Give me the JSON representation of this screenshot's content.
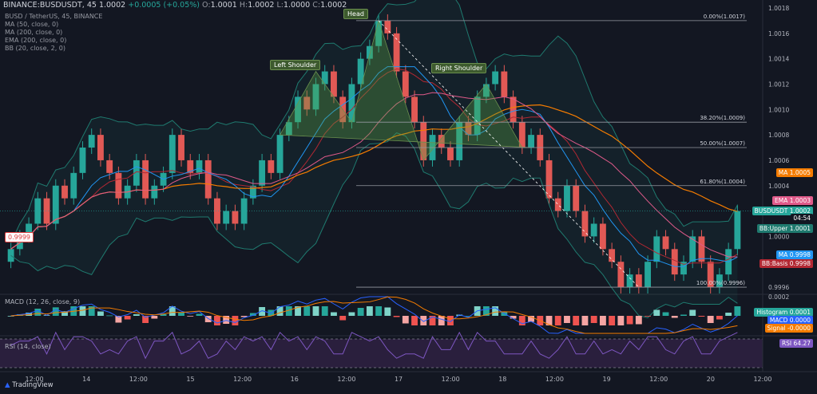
{
  "header": {
    "symbol": "BINANCE:BUSDUSDT, 45",
    "close_value": "1.0002",
    "change": "+0.0005 (+0.05%)",
    "o_label": "O:",
    "o_value": "1.0001",
    "h_label": "H:",
    "h_value": "1.0002",
    "l_label": "L:",
    "l_value": "1.0000",
    "c_label": "C:",
    "c_value": "1.0002"
  },
  "indicators": [
    "BUSD / TetherUS, 45, BINANCE",
    "MA (50, close, 0)",
    "MA (200, close, 0)",
    "EMA (200, close, 0)",
    "BB (20, close, 2, 0)"
  ],
  "patterns": {
    "head": "Head",
    "left_shoulder": "Left Shoulder",
    "right_shoulder": "Right Shoulder"
  },
  "fib_levels": [
    {
      "label": "0.00%(1.0017)",
      "price": 1.0017
    },
    {
      "label": "38.20%(1.0009)",
      "price": 1.0009
    },
    {
      "label": "50.00%(1.0007)",
      "price": 1.0007
    },
    {
      "label": "61.80%(1.0004)",
      "price": 1.0004
    },
    {
      "label": "100.00%(0.9996)",
      "price": 0.9996
    }
  ],
  "price_tags": [
    {
      "label": "MA",
      "value": "1.0005",
      "color": "#f57c00",
      "price": 1.0005
    },
    {
      "label": "EMA",
      "value": "1.0003",
      "color": "#e05a8a",
      "price": 1.00028
    },
    {
      "label": "BUSDUSDT",
      "value": "1.0002",
      "color": "#26a69a",
      "price": 1.0002
    },
    {
      "label": "",
      "value": "04:54",
      "color": "#131722",
      "price": 1.00014
    },
    {
      "label": "BB:Upper",
      "value": "1.0001",
      "color": "#1f7a6f",
      "price": 1.00006
    },
    {
      "label": "MA",
      "value": "0.9998",
      "color": "#2196f3",
      "price": 0.99985
    },
    {
      "label": "BB:Basis",
      "value": "0.9998",
      "color": "#b22833",
      "price": 0.99978
    }
  ],
  "left_price_tag": "0.9999",
  "macd": {
    "label": "MACD (12, 26, close, 9)",
    "tags": [
      {
        "label": "Histogram",
        "value": "0.0001",
        "color": "#26a69a"
      },
      {
        "label": "MACD",
        "value": "0.0000",
        "color": "#2962ff"
      },
      {
        "label": "Signal",
        "value": "-0.0000",
        "color": "#f57c00"
      }
    ],
    "axis_label": "0.0002"
  },
  "rsi": {
    "label": "RSI (14, close)",
    "tag_label": "RSI",
    "tag_value": "64.27",
    "color": "#7e57c2"
  },
  "footer": {
    "brand": "TradingView"
  },
  "chart_data": {
    "type": "candlestick",
    "title": "BUSD / TetherUS, 45, BINANCE",
    "y_ticks": [
      "1.0018",
      "1.0016",
      "1.0014",
      "1.0012",
      "1.0010",
      "1.0008",
      "1.0006",
      "1.0004",
      "1.0002",
      "1.0000",
      "0.9998",
      "0.9996"
    ],
    "ylim": [
      0.99955,
      1.0018
    ],
    "x_ticks": [
      "12:00",
      "14",
      "12:00",
      "15",
      "12:00",
      "16",
      "12:00",
      "17",
      "12:00",
      "18",
      "12:00",
      "19",
      "12:00",
      "20",
      "12:00"
    ],
    "x_range": [
      0,
      14.6
    ],
    "closes": [
      0.9999,
      1.0,
      1.0001,
      1.0003,
      1.0001,
      1.0004,
      1.0003,
      1.0005,
      1.0007,
      1.0008,
      1.0006,
      1.0005,
      1.0003,
      1.0004,
      1.0006,
      1.0003,
      1.0004,
      1.0005,
      1.0008,
      1.0006,
      1.0005,
      1.0006,
      1.0003,
      1.0001,
      1.0002,
      1.0001,
      1.0003,
      1.0004,
      1.0006,
      1.0005,
      1.0008,
      1.0009,
      1.0011,
      1.001,
      1.0012,
      1.0013,
      1.0011,
      1.0009,
      1.0012,
      1.0014,
      1.0015,
      1.0017,
      1.0016,
      1.0013,
      1.0011,
      1.0009,
      1.0006,
      1.0008,
      1.0007,
      1.0006,
      1.0009,
      1.0008,
      1.0011,
      1.0012,
      1.0013,
      1.0011,
      1.0009,
      1.0007,
      1.0008,
      1.0006,
      1.0003,
      1.0002,
      1.0004,
      1.0002,
      1.0,
      1.0001,
      0.9999,
      0.9998,
      0.9996,
      0.9997,
      0.9996,
      0.9998,
      1.0,
      0.9999,
      0.9997,
      0.9998,
      1.0,
      0.9998,
      0.9996,
      0.9997,
      0.9999,
      1.0002
    ],
    "series": [
      {
        "name": "MA (50, close, 0)",
        "color": "#2196f3"
      },
      {
        "name": "MA (200, close, 0)",
        "color": "#f57c00"
      },
      {
        "name": "EMA (200, close, 0)",
        "color": "#e05a8a"
      },
      {
        "name": "BB (20, close, 2, 0)",
        "color": "#26a69a"
      }
    ]
  }
}
